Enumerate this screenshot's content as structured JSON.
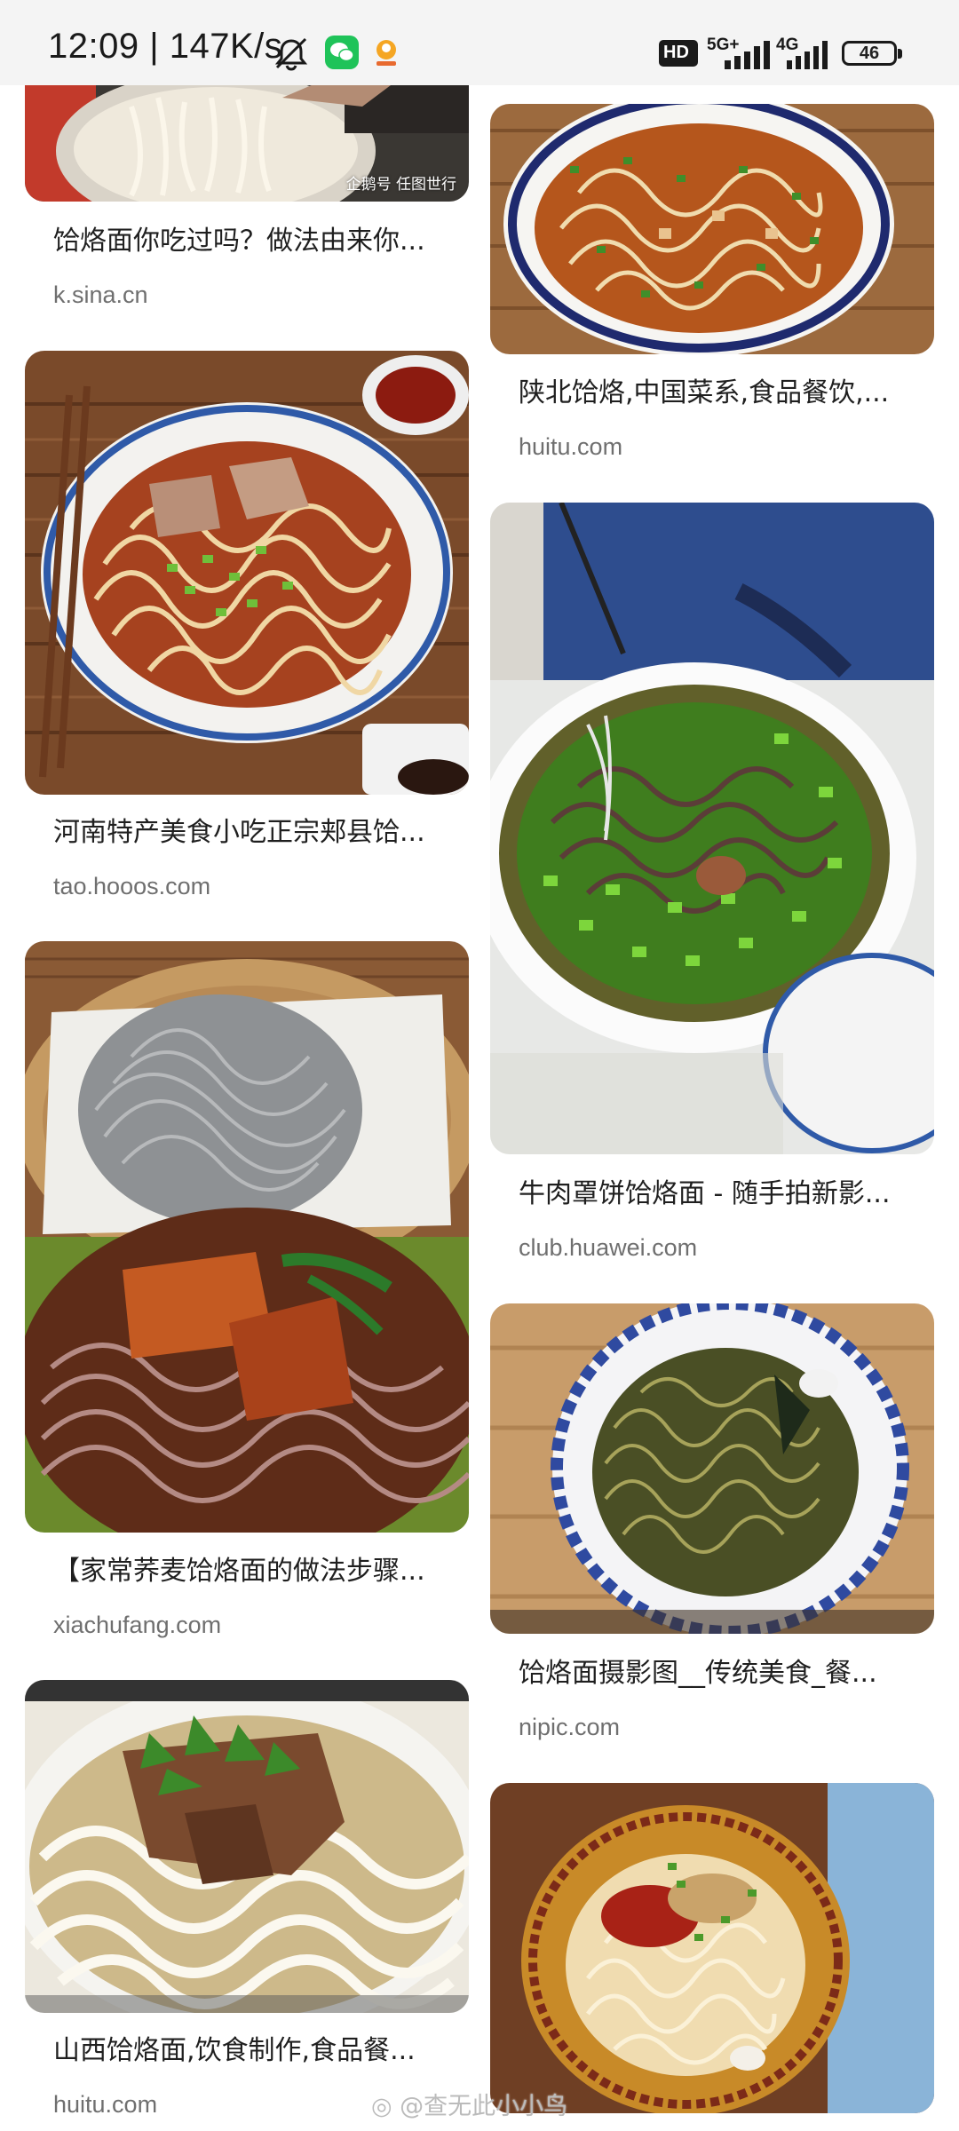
{
  "status_bar": {
    "time": "12:09",
    "speed": "147K/s",
    "icons": [
      "bell-off-icon",
      "wechat-icon",
      "app-notification-icon",
      "hd-icon",
      "signal-5g-icon",
      "signal-4g-icon"
    ],
    "hd_label": "HD",
    "net1_label": "5G+",
    "net2_label": "4G",
    "battery": "46"
  },
  "feed": {
    "left": [
      {
        "title": "饸烙面你吃过吗？做法由来你...",
        "source": "k.sina.cn",
        "image": "noodles-being-lifted-photo",
        "watermark": "企鹅号 任图世行"
      },
      {
        "title": "河南特产美食小吃正宗郏县饸...",
        "source": "tao.hooos.com",
        "image": "beef-noodle-bowl-photo"
      },
      {
        "title": "【家常荞麦饸烙面的做法步骤...",
        "source": "xiachufang.com",
        "image": "buckwheat-noodles-collage-photo"
      },
      {
        "title": "山西饸烙面,饮食制作,食品餐...",
        "source": "huitu.com",
        "image": "pork-noodle-soup-photo"
      }
    ],
    "right": [
      {
        "title": "陕北饸烙,中国菜系,食品餐饮,...",
        "source": "huitu.com",
        "image": "spicy-noodle-bowl-photo"
      },
      {
        "title": "牛肉罩饼饸烙面 - 随手拍新影...",
        "source": "club.huawei.com",
        "image": "green-onion-noodle-soup-photo"
      },
      {
        "title": "饸烙面摄影图__传统美食_餐...",
        "source": "nipic.com",
        "image": "blue-plate-noodles-photo"
      },
      {
        "title": "",
        "source": "",
        "image": "chili-topped-noodles-photo"
      }
    ]
  },
  "bottom_watermark": "@查无此小小鸟"
}
